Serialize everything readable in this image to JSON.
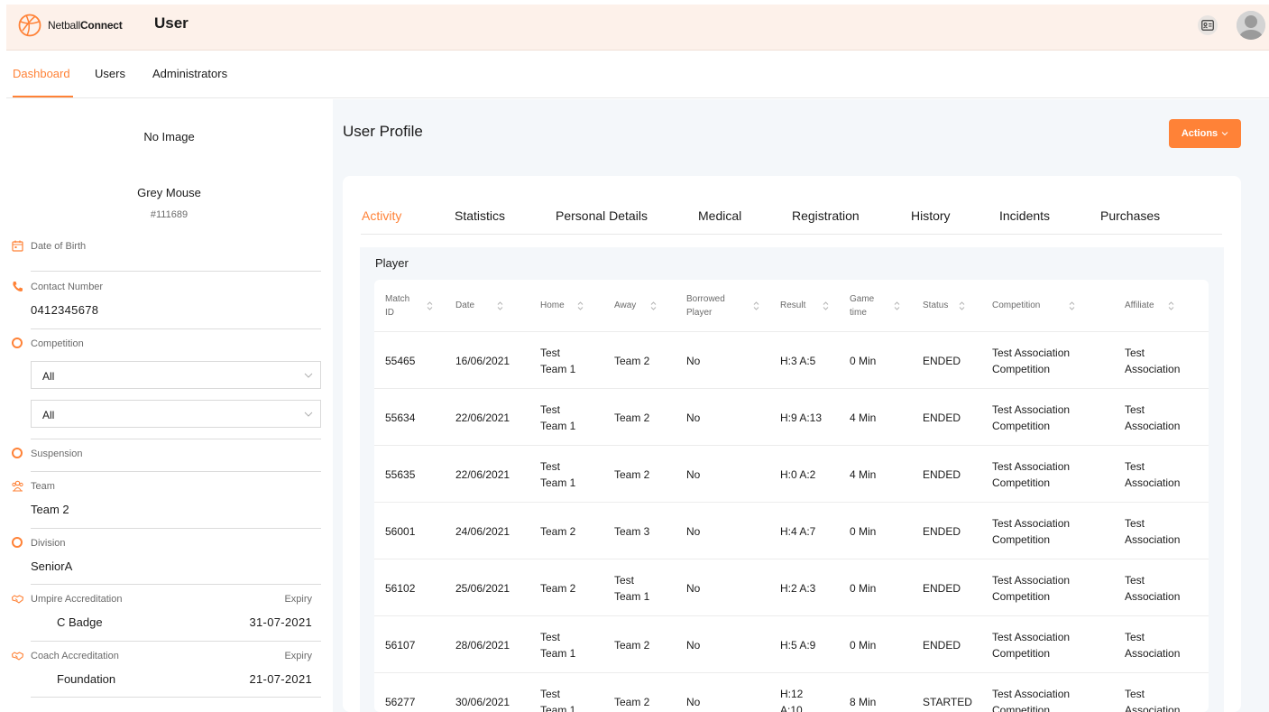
{
  "header": {
    "brand_prefix": "Netball",
    "brand_suffix": "Connect",
    "title": "User",
    "accent_color": "#ff8237"
  },
  "nav": {
    "items": [
      {
        "label": "Dashboard",
        "active": true
      },
      {
        "label": "Users",
        "active": false
      },
      {
        "label": "Administrators",
        "active": false
      }
    ]
  },
  "sidebar": {
    "no_image": "No Image",
    "name": "Grey Mouse",
    "id": "#111689",
    "dob_label": "Date of Birth",
    "contact_label": "Contact Number",
    "contact_value": "0412345678",
    "competition_label": "Competition",
    "competition_select_1": "All",
    "competition_select_2": "All",
    "suspension_label": "Suspension",
    "team_label": "Team",
    "team_value": "Team 2",
    "division_label": "Division",
    "division_value": "SeniorA",
    "umpire_label": "Umpire Accreditation",
    "umpire_expiry_label": "Expiry",
    "umpire_value": "C Badge",
    "umpire_expiry": "31-07-2021",
    "coach_label": "Coach Accreditation",
    "coach_expiry_label": "Expiry",
    "coach_value": "Foundation",
    "coach_expiry": "21-07-2021"
  },
  "main": {
    "title": "User Profile",
    "actions_label": "Actions",
    "tabs": [
      {
        "label": "Activity",
        "active": true
      },
      {
        "label": "Statistics",
        "active": false
      },
      {
        "label": "Personal Details",
        "active": false
      },
      {
        "label": "Medical",
        "active": false
      },
      {
        "label": "Registration",
        "active": false
      },
      {
        "label": "History",
        "active": false
      },
      {
        "label": "Incidents",
        "active": false
      },
      {
        "label": "Purchases",
        "active": false
      }
    ],
    "section_label": "Player",
    "columns": [
      {
        "l1": "Match",
        "l2": "ID"
      },
      {
        "l1": "Date",
        "l2": ""
      },
      {
        "l1": "Home",
        "l2": ""
      },
      {
        "l1": "Away",
        "l2": ""
      },
      {
        "l1": "Borrowed",
        "l2": "Player"
      },
      {
        "l1": "Result",
        "l2": ""
      },
      {
        "l1": "Game",
        "l2": "time"
      },
      {
        "l1": "Status",
        "l2": ""
      },
      {
        "l1": "Competition",
        "l2": ""
      },
      {
        "l1": "Affiliate",
        "l2": ""
      }
    ],
    "rows": [
      {
        "match_id": "55465",
        "date": "16/06/2021",
        "home_1": "Test",
        "home_2": "Team 1",
        "away_1": "Team 2",
        "away_2": "",
        "borrowed": "No",
        "result_1": "H:3 A:5",
        "result_2": "",
        "game_time": "0 Min",
        "status": "ENDED",
        "competition_1": "Test Association",
        "competition_2": "Competition",
        "affiliate_1": "Test",
        "affiliate_2": "Association"
      },
      {
        "match_id": "55634",
        "date": "22/06/2021",
        "home_1": "Test",
        "home_2": "Team 1",
        "away_1": "Team 2",
        "away_2": "",
        "borrowed": "No",
        "result_1": "H:9 A:13",
        "result_2": "",
        "game_time": "4 Min",
        "status": "ENDED",
        "competition_1": "Test Association",
        "competition_2": "Competition",
        "affiliate_1": "Test",
        "affiliate_2": "Association"
      },
      {
        "match_id": "55635",
        "date": "22/06/2021",
        "home_1": "Test",
        "home_2": "Team 1",
        "away_1": "Team 2",
        "away_2": "",
        "borrowed": "No",
        "result_1": "H:0 A:2",
        "result_2": "",
        "game_time": "4 Min",
        "status": "ENDED",
        "competition_1": "Test Association",
        "competition_2": "Competition",
        "affiliate_1": "Test",
        "affiliate_2": "Association"
      },
      {
        "match_id": "56001",
        "date": "24/06/2021",
        "home_1": "Team 2",
        "home_2": "",
        "away_1": "Team 3",
        "away_2": "",
        "borrowed": "No",
        "result_1": "H:4 A:7",
        "result_2": "",
        "game_time": "0 Min",
        "status": "ENDED",
        "competition_1": "Test Association",
        "competition_2": "Competition",
        "affiliate_1": "Test",
        "affiliate_2": "Association"
      },
      {
        "match_id": "56102",
        "date": "25/06/2021",
        "home_1": "Team 2",
        "home_2": "",
        "away_1": "Test",
        "away_2": "Team 1",
        "borrowed": "No",
        "result_1": "H:2 A:3",
        "result_2": "",
        "game_time": "0 Min",
        "status": "ENDED",
        "competition_1": "Test Association",
        "competition_2": "Competition",
        "affiliate_1": "Test",
        "affiliate_2": "Association"
      },
      {
        "match_id": "56107",
        "date": "28/06/2021",
        "home_1": "Test",
        "home_2": "Team 1",
        "away_1": "Team 2",
        "away_2": "",
        "borrowed": "No",
        "result_1": "H:5 A:9",
        "result_2": "",
        "game_time": "0 Min",
        "status": "ENDED",
        "competition_1": "Test Association",
        "competition_2": "Competition",
        "affiliate_1": "Test",
        "affiliate_2": "Association"
      },
      {
        "match_id": "56277",
        "date": "30/06/2021",
        "home_1": "Test",
        "home_2": "Team 1",
        "away_1": "Team 2",
        "away_2": "",
        "borrowed": "No",
        "result_1": "H:12",
        "result_2": "A:10",
        "game_time": "8 Min",
        "status": "STARTED",
        "competition_1": "Test Association",
        "competition_2": "Competition",
        "affiliate_1": "Test",
        "affiliate_2": "Association"
      }
    ]
  }
}
